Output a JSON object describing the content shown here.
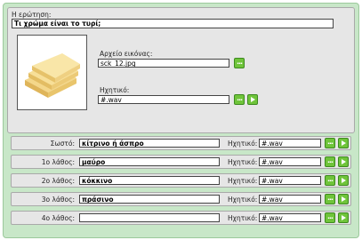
{
  "question": {
    "label": "Η ερώτηση:",
    "text": "Τι χρώμα είναι το τυρί;"
  },
  "media": {
    "image_label": "Αρχείο εικόνας:",
    "image_file": "sck_12.jpg",
    "audio_label": "Ηχητικό:",
    "audio_file": "#.wav"
  },
  "answers": [
    {
      "label": "Σωστό:",
      "value": "κίτρινο ή άσπρο",
      "audio_label": "Ηχητικό:",
      "audio_file": "#.wav"
    },
    {
      "label": "1ο λάθος:",
      "value": "μαύρο",
      "audio_label": "Ηχητικό:",
      "audio_file": "#.wav"
    },
    {
      "label": "2ο λάθος:",
      "value": "κόκκινο",
      "audio_label": "Ηχητικό:",
      "audio_file": "#.wav"
    },
    {
      "label": "3ο λάθος:",
      "value": "πράσινο",
      "audio_label": "Ηχητικό:",
      "audio_file": "#.wav"
    },
    {
      "label": "4ο λάθος:",
      "value": "",
      "audio_label": "Ηχητικό:",
      "audio_file": "#.wav"
    }
  ],
  "icons": {
    "browse": "browse-dots-icon",
    "play": "play-icon"
  },
  "colors": {
    "background": "#c8e7c8",
    "panel": "#e6e6e6",
    "button": "#6fc43a"
  }
}
